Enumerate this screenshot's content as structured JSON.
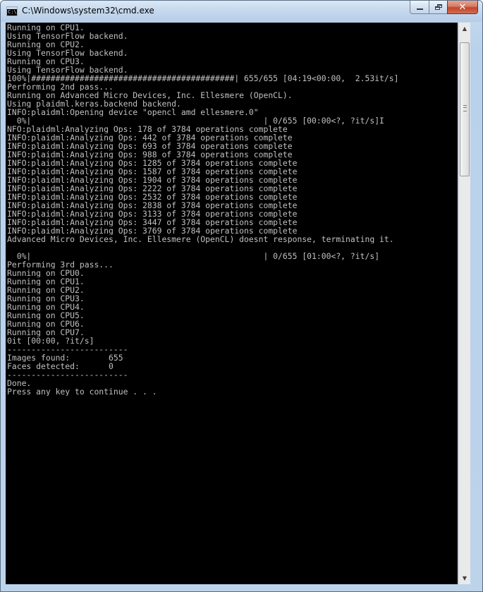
{
  "window": {
    "title": "C:\\Windows\\system32\\cmd.exe",
    "icon": "cmd-icon",
    "icon_text": "C:\\"
  },
  "caption_buttons": {
    "minimize_icon": "minimize-icon",
    "maximize_icon": "restore-icon",
    "close_icon": "close-icon",
    "close_glyph": "✕"
  },
  "console": {
    "background": "#000000",
    "foreground": "#c0c0c0",
    "lines": [
      "Running on CPU1.",
      "Using TensorFlow backend.",
      "Running on CPU2.",
      "Using TensorFlow backend.",
      "Running on CPU3.",
      "Using TensorFlow backend.",
      "100%|##########################################| 655/655 [04:19<00:00,  2.53it/s]",
      "Performing 2nd pass...",
      "Running on Advanced Micro Devices, Inc. Ellesmere (OpenCL).",
      "Using plaidml.keras.backend backend.",
      "INFO:plaidml:Opening device \"opencl_amd_ellesmere.0\"",
      "  0%|                                                | 0/655 [00:00<?, ?it/s]I",
      "NFO:plaidml:Analyzing Ops: 178 of 3784 operations complete",
      "INFO:plaidml:Analyzing Ops: 442 of 3784 operations complete",
      "INFO:plaidml:Analyzing Ops: 693 of 3784 operations complete",
      "INFO:plaidml:Analyzing Ops: 988 of 3784 operations complete",
      "INFO:plaidml:Analyzing Ops: 1285 of 3784 operations complete",
      "INFO:plaidml:Analyzing Ops: 1587 of 3784 operations complete",
      "INFO:plaidml:Analyzing Ops: 1904 of 3784 operations complete",
      "INFO:plaidml:Analyzing Ops: 2222 of 3784 operations complete",
      "INFO:plaidml:Analyzing Ops: 2532 of 3784 operations complete",
      "INFO:plaidml:Analyzing Ops: 2838 of 3784 operations complete",
      "INFO:plaidml:Analyzing Ops: 3133 of 3784 operations complete",
      "INFO:plaidml:Analyzing Ops: 3447 of 3784 operations complete",
      "INFO:plaidml:Analyzing Ops: 3769 of 3784 operations complete",
      "Advanced Micro Devices, Inc. Ellesmere (OpenCL) doesnt response, terminating it.",
      "",
      "  0%|                                                | 0/655 [01:00<?, ?it/s]",
      "Performing 3rd pass...",
      "Running on CPU0.",
      "Running on CPU1.",
      "Running on CPU2.",
      "Running on CPU3.",
      "Running on CPU4.",
      "Running on CPU5.",
      "Running on CPU6.",
      "Running on CPU7.",
      "0it [00:00, ?it/s]",
      "-------------------------",
      "Images found:        655",
      "Faces detected:      0",
      "-------------------------",
      "Done.",
      "Press any key to continue . . ."
    ]
  },
  "scrollbar": {
    "up_arrow": "▲",
    "down_arrow": "▼",
    "up_icon": "scroll-up-arrow-icon",
    "down_icon": "scroll-down-arrow-icon"
  }
}
